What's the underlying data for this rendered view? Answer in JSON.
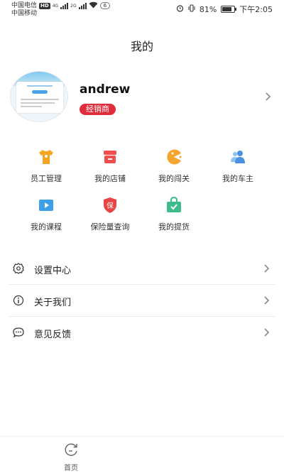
{
  "status_bar": {
    "carrier1": "中国电信",
    "carrier1_badge": "HD",
    "net1": "4G",
    "net2": "2G",
    "carrier2": "中国移动",
    "notification_count": "6",
    "battery": "81%",
    "time": "下午2:05"
  },
  "header": {
    "title": "我的"
  },
  "profile": {
    "username": "andrew",
    "role": "经销商"
  },
  "grid": [
    {
      "label": "员工管理",
      "icon": "tshirt-icon",
      "color": "#f5a524"
    },
    {
      "label": "我的店铺",
      "icon": "store-icon",
      "color": "#f04e4e"
    },
    {
      "label": "我的闯关",
      "icon": "pacman-icon",
      "color": "#f7a531"
    },
    {
      "label": "我的车主",
      "icon": "users-icon",
      "color": "#4a90e2"
    },
    {
      "label": "我的课程",
      "icon": "play-icon",
      "color": "#3c9fe8"
    },
    {
      "label": "保险量查询",
      "icon": "insurance-shield-icon",
      "color": "#e84444",
      "glyph": "保"
    },
    {
      "label": "我的提货",
      "icon": "shopping-bag-icon",
      "color": "#3dbb8a"
    }
  ],
  "menu": [
    {
      "label": "设置中心",
      "icon": "gear-icon"
    },
    {
      "label": "关于我们",
      "icon": "info-icon"
    },
    {
      "label": "意见反馈",
      "icon": "chat-icon"
    }
  ],
  "bottom_nav": {
    "home_label": "首页",
    "icon": "home-refresh-icon"
  },
  "colors": {
    "accent": "#e02d3c"
  }
}
